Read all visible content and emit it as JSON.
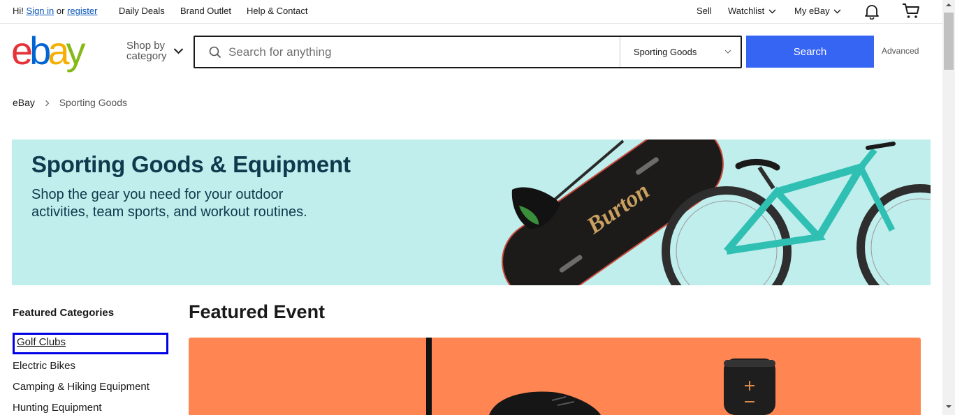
{
  "topbar": {
    "greeting": "Hi!",
    "sign_in": "Sign in",
    "or": "or",
    "register": "register",
    "daily_deals": "Daily Deals",
    "brand_outlet": "Brand Outlet",
    "help_contact": "Help & Contact",
    "sell": "Sell",
    "watchlist": "Watchlist",
    "my_ebay": "My eBay",
    "icons": [
      "chevron-down-icon",
      "bell-icon",
      "cart-icon"
    ]
  },
  "header": {
    "logo_letters": [
      "e",
      "b",
      "a",
      "y"
    ],
    "shop_by_line1": "Shop by",
    "shop_by_line2": "category",
    "search_placeholder": "Search for anything",
    "search_value": "",
    "category_selected": "Sporting Goods",
    "search_button": "Search",
    "advanced": "Advanced"
  },
  "breadcrumb": {
    "home": "eBay",
    "current": "Sporting Goods"
  },
  "banner": {
    "title": "Sporting Goods & Equipment",
    "line1": "Shop the gear you need for your outdoor",
    "line2": "activities, team sports, and workout routines.",
    "board_text": "Burton"
  },
  "sidebar": {
    "title": "Featured Categories",
    "items": [
      {
        "label": "Golf Clubs"
      },
      {
        "label": "Electric Bikes"
      },
      {
        "label": "Camping & Hiking Equipment"
      },
      {
        "label": "Hunting Equipment"
      }
    ]
  },
  "featured": {
    "title": "Featured Event"
  },
  "colors": {
    "accent": "#3665f3",
    "banner_bg": "#c0eeec",
    "banner_text": "#0e3a4d",
    "event_bg": "#ff8552",
    "focus_outline": "#0000e6",
    "logo_e": "#e53238",
    "logo_b": "#0064d2",
    "logo_a": "#f5af02",
    "logo_y": "#86b817"
  }
}
